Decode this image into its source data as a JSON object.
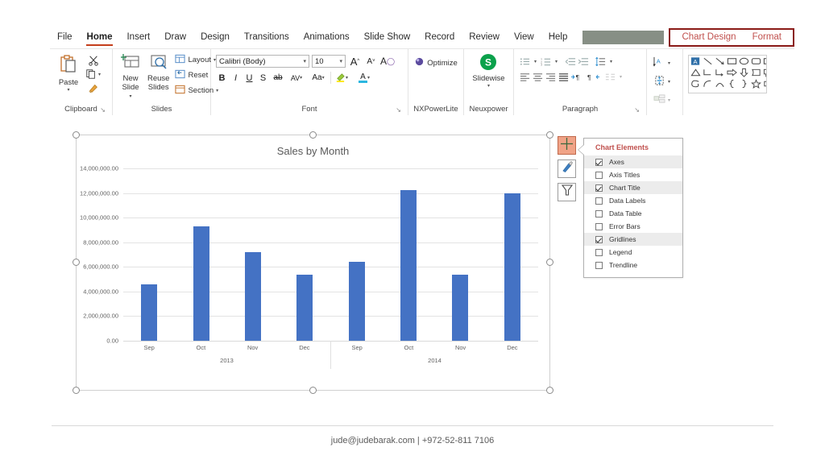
{
  "ribbon": {
    "tabs": [
      {
        "label": "File",
        "active": false
      },
      {
        "label": "Home",
        "active": true
      },
      {
        "label": "Insert",
        "active": false
      },
      {
        "label": "Draw",
        "active": false
      },
      {
        "label": "Design",
        "active": false
      },
      {
        "label": "Transitions",
        "active": false
      },
      {
        "label": "Animations",
        "active": false
      },
      {
        "label": "Slide Show",
        "active": false
      },
      {
        "label": "Record",
        "active": false
      },
      {
        "label": "Review",
        "active": false
      },
      {
        "label": "View",
        "active": false
      },
      {
        "label": "Help",
        "active": false
      }
    ],
    "contextual_tabs": [
      {
        "label": "Chart Design"
      },
      {
        "label": "Format"
      }
    ],
    "contextual_border_color": "#8a1a17",
    "contextual_text_color": "#c0504d",
    "redacted_box_color": "#878f85",
    "groups": {
      "clipboard": {
        "label": "Clipboard",
        "paste_label": "Paste",
        "cut_icon": "scissors-icon",
        "copy_icon": "copy-icon",
        "format_painter_icon": "format-painter-icon",
        "dialog_launcher": "↘"
      },
      "slides": {
        "label": "Slides",
        "new_slide_label": "New\nSlide",
        "new_slide_line1": "New",
        "new_slide_line2": "Slide",
        "reuse_slides_line1": "Reuse",
        "reuse_slides_line2": "Slides",
        "layout_label": "Layout",
        "reset_label": "Reset",
        "section_label": "Section"
      },
      "font": {
        "label": "Font",
        "font_name_value": "Calibri (Body)",
        "font_size_value": "10",
        "grow_font": "A",
        "shrink_font": "A",
        "clear_formatting": "A",
        "bold": "B",
        "italic": "I",
        "underline": "U",
        "shadow": "S",
        "strikethrough": "ab",
        "character_spacing": "AV",
        "change_case": "Aa",
        "text_highlight": "text-highlight-icon",
        "font_color": "A",
        "dialog_launcher": "↘"
      },
      "nxpowerlite": {
        "label": "NXPowerLite",
        "optimize_label": "Optimize"
      },
      "neuxpower": {
        "label": "Neuxpower",
        "slidewise_label": "Slidewise",
        "slidewise_badge": "S",
        "slidewise_color": "#0ba14b"
      },
      "paragraph": {
        "label": "Paragraph",
        "dialog_launcher": "↘"
      },
      "drawing": {
        "shapes_gallery_row1": [
          "A",
          "╲",
          "╲",
          "▭",
          "◯",
          "▭"
        ],
        "shapes_gallery_row2": [
          "△",
          "┐",
          "┐",
          "⇒",
          "⇓",
          "▭"
        ],
        "shapes_gallery_row3": [
          "⤵",
          "⌒",
          "⌒",
          "{",
          "}",
          "☆"
        ]
      }
    }
  },
  "chart": {
    "selected": true,
    "handle_count": 8,
    "side_buttons": [
      {
        "name": "chart-elements-button",
        "icon": "plus-icon",
        "selected": true
      },
      {
        "name": "chart-styles-button",
        "icon": "paintbrush-icon",
        "selected": false
      },
      {
        "name": "chart-filters-button",
        "icon": "funnel-icon",
        "selected": false
      }
    ]
  },
  "chart_elements_panel": {
    "title": "Chart Elements",
    "items": [
      {
        "label": "Axes",
        "checked": true
      },
      {
        "label": "Axis Titles",
        "checked": false
      },
      {
        "label": "Chart Title",
        "checked": true
      },
      {
        "label": "Data Labels",
        "checked": false
      },
      {
        "label": "Data Table",
        "checked": false
      },
      {
        "label": "Error Bars",
        "checked": false
      },
      {
        "label": "Gridlines",
        "checked": true
      },
      {
        "label": "Legend",
        "checked": false
      },
      {
        "label": "Trendline",
        "checked": false
      }
    ]
  },
  "chart_data": {
    "type": "bar",
    "title": "Sales by Month",
    "xlabel": "",
    "ylabel": "",
    "grid": true,
    "legend": false,
    "legend_position": "none",
    "bar_color": "#4472C4",
    "ylim": [
      0,
      14000000
    ],
    "ytick_labels": [
      "14,000,000.00",
      "12,000,000.00",
      "10,000,000.00",
      "8,000,000.00",
      "6,000,000.00",
      "4,000,000.00",
      "2,000,000.00",
      "0.00"
    ],
    "ytick_values": [
      14000000,
      12000000,
      10000000,
      8000000,
      6000000,
      4000000,
      2000000,
      0
    ],
    "groups": [
      {
        "label": "2013",
        "categories": [
          "Sep",
          "Oct",
          "Nov",
          "Dec"
        ]
      },
      {
        "label": "2014",
        "categories": [
          "Sep",
          "Oct",
          "Nov",
          "Dec"
        ]
      }
    ],
    "categories": [
      "Sep",
      "Oct",
      "Nov",
      "Dec",
      "Sep",
      "Oct",
      "Nov",
      "Dec"
    ],
    "values": [
      4600000,
      9300000,
      7200000,
      5350000,
      6400000,
      12250000,
      5350000,
      11950000
    ]
  },
  "footer": {
    "text": "jude@judebarak.com | +972-52-811 7106"
  }
}
